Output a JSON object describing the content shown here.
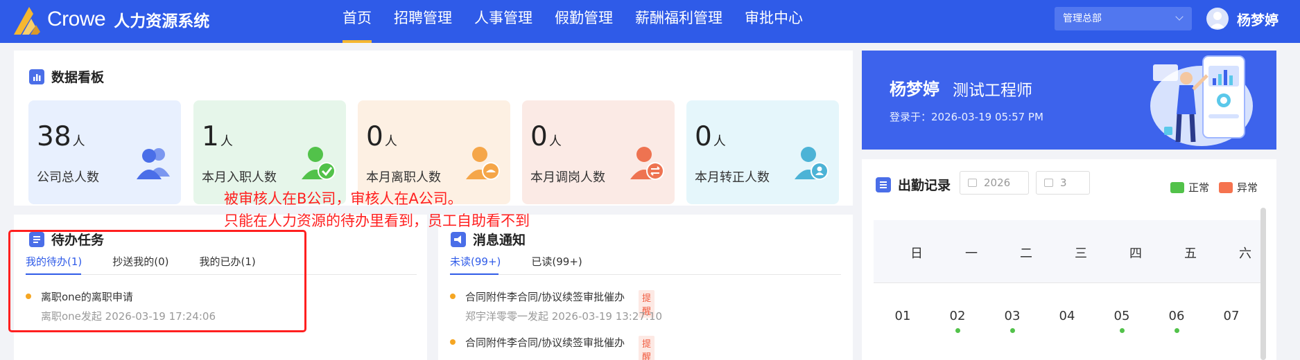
{
  "header": {
    "logo_word": "Crowe",
    "system_name": "人力资源系统",
    "nav": [
      {
        "label": "首页",
        "active": true
      },
      {
        "label": "招聘管理",
        "active": false
      },
      {
        "label": "人事管理",
        "active": false
      },
      {
        "label": "假勤管理",
        "active": false
      },
      {
        "label": "薪酬福利管理",
        "active": false
      },
      {
        "label": "审批中心",
        "active": false
      }
    ],
    "org_select": "管理总部",
    "user_name": "杨梦婷"
  },
  "dashboard": {
    "title": "数据看板",
    "stats": [
      {
        "value": "38",
        "unit": "人",
        "label": "公司总人数",
        "bg": "#e8f0fe",
        "icon_color": "#4a6ee8",
        "icon": "users-icon"
      },
      {
        "value": "1",
        "unit": "人",
        "label": "本月入职人数",
        "bg": "#e6f6ea",
        "icon_color": "#52c24a",
        "icon": "user-check-icon"
      },
      {
        "value": "0",
        "unit": "人",
        "label": "本月离职人数",
        "bg": "#fdf0e3",
        "icon_color": "#f5a649",
        "icon": "user-leave-icon"
      },
      {
        "value": "0",
        "unit": "人",
        "label": "本月调岗人数",
        "bg": "#fbeae5",
        "icon_color": "#ee7351",
        "icon": "user-transfer-icon"
      },
      {
        "value": "0",
        "unit": "人",
        "label": "本月转正人数",
        "bg": "#e5f6fb",
        "icon_color": "#4cb3d6",
        "icon": "user-regular-icon"
      }
    ]
  },
  "annotation": {
    "line1": "被审核人在B公司，审核人在A公司。",
    "line2": "只能在人力资源的待办里看到，员工自助看不到"
  },
  "todo": {
    "title": "待办任务",
    "tabs": [
      "我的待办(1)",
      "抄送我的(0)",
      "我的已办(1)"
    ],
    "items": [
      {
        "title": "离职one的离职申请",
        "sub": "离职one发起   2026-03-19 17:24:06"
      }
    ]
  },
  "messages": {
    "title": "消息通知",
    "tabs": [
      "未读(99+)",
      "已读(99+)"
    ],
    "items": [
      {
        "title": "合同附件李合同/协议续签审批催办",
        "badge": "提醒",
        "sub": "郑宇洋零零一发起   2026-03-19 13:27:10"
      },
      {
        "title": "合同附件李合同/协议续签审批催办",
        "badge": "提醒",
        "sub": ""
      }
    ]
  },
  "banner": {
    "name": "杨梦婷",
    "role": "测试工程师",
    "login": "登录于：2026-03-19 05:57 PM"
  },
  "attendance": {
    "title": "出勤记录",
    "year": "2026",
    "month": "3",
    "legend": [
      {
        "label": "正常",
        "color": "#52c24a"
      },
      {
        "label": "异常",
        "color": "#f5734f"
      }
    ],
    "weekdays": [
      "日",
      "一",
      "二",
      "三",
      "四",
      "五",
      "六"
    ],
    "days": [
      "01",
      "02",
      "03",
      "04",
      "05",
      "06",
      "07"
    ]
  }
}
